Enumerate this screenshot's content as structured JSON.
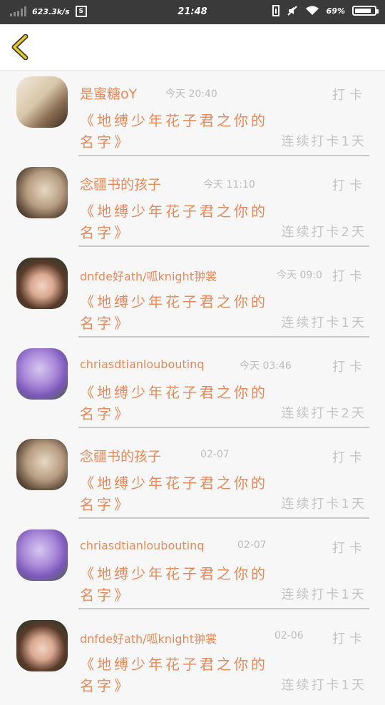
{
  "status_bar": {
    "speed": "623.3k/s",
    "time": "21:48",
    "battery_pct": "69%"
  },
  "header": {
    "back_icon": "chevron-left-icon",
    "accent_color": "#d4b11e"
  },
  "colors": {
    "name": "#e8895a",
    "muted": "#c4c4c4"
  },
  "items": [
    {
      "name": "是蜜糖oY",
      "time": "今天  20:40",
      "checkin": "打卡",
      "book": "《地缚少年花子君之你的名字》",
      "streak": "连续打卡1天",
      "avatar": "cat-avatar"
    },
    {
      "name": "念疆书的孩子",
      "time": "今天  11:10",
      "checkin": "打卡",
      "book": "《地缚少年花子君之你的名字》",
      "streak": "连续打卡2天",
      "avatar": "sketch-avatar"
    },
    {
      "name": "dnfde好ath/呱knight翀裳",
      "time": "今天  09:0",
      "checkin": "打卡",
      "book": "《地缚少年花子君之你的名字》",
      "streak": "连续打卡1天",
      "avatar": "girl-avatar"
    },
    {
      "name": "chriasdtianlouboutinq",
      "time": "今天  03:46",
      "checkin": "打卡",
      "book": "《地缚少年花子君之你的名字》",
      "streak": "连续打卡2天",
      "avatar": "flower-avatar"
    },
    {
      "name": "念疆书的孩子",
      "time": "02-07",
      "checkin": "打卡",
      "book": "《地缚少年花子君之你的名字》",
      "streak": "连续打卡1天",
      "avatar": "sketch-avatar"
    },
    {
      "name": "chriasdtianlouboutinq",
      "time": "02-07",
      "checkin": "打卡",
      "book": "《地缚少年花子君之你的名字》",
      "streak": "连续打卡1天",
      "avatar": "flower-avatar"
    },
    {
      "name": "dnfde好ath/呱knight翀裳",
      "time": "02-06",
      "checkin": "打卡",
      "book": "《地缚少年花子君之你的名字》",
      "streak": "连续打卡1天",
      "avatar": "girl-avatar"
    }
  ]
}
